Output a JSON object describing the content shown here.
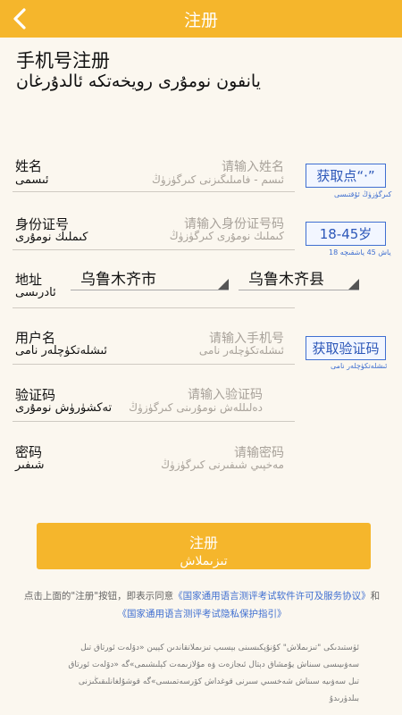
{
  "topbar": {
    "title": "注册",
    "back_label": "‹"
  },
  "heading": {
    "title_zh": "手机号注册",
    "title_ug": "يانفون نومۇرى رويخەتكە ئالدۇرغان"
  },
  "form": {
    "name": {
      "label_zh": "姓名",
      "label_ug": "ئىسمى",
      "placeholder_zh": "请输入姓名",
      "placeholder_ug": "ئىسم - فامىلىگىزنى كىرگۈزۈڭ",
      "button": "获取点“·”",
      "button_note": "كىرگۈزۈڭ ئۇقتىسى"
    },
    "id_number": {
      "label_zh": "身份证号",
      "label_ug": "كىملىك نومۇرى",
      "placeholder_zh": "请输入身份证号码",
      "placeholder_ug": "كىملىك نومۇرى كىرگۈزۈڭ",
      "button": "18-45岁",
      "button_note": "18 ياش 45 ياشقىچە"
    },
    "address": {
      "label_zh": "地址",
      "label_ug": "ئادرىسى",
      "city": "乌鲁木齐市",
      "county": "乌鲁木齐县"
    },
    "username": {
      "label_zh": "用户名",
      "label_ug": "ئىشلەتكۈچلەر نامى",
      "placeholder_zh": "请输入手机号",
      "placeholder_ug": "ئىشلەتكۈچلەر نامى",
      "button": "获取验证码",
      "button_note": "ئىشلەتكۈچلەر نامى"
    },
    "code": {
      "label_zh": "验证码",
      "label_ug": "تەكشۈرۈش نومۇرى",
      "placeholder_zh": "请输入验证码",
      "placeholder_ug": "دەلىللەش نومۇرىنى كىرگۈزۈڭ"
    },
    "password": {
      "label_zh": "密码",
      "label_ug": "شىفىر",
      "placeholder_zh": "请输密码",
      "placeholder_ug": "مەخپىي شىفىرنى كىرگۈزۈڭ"
    }
  },
  "register_button": {
    "label_zh": "注册",
    "label_ug": "تىزىملاش"
  },
  "agreement": {
    "prefix": "点击上面的\"注册\"按钮，即表示同意",
    "link1": "《国家通用语言测评考试软件许可及服务协议》",
    "conj": "和",
    "link2": "《国家通用语言测评考试隐私保护指引》",
    "ug_text": "ئۈستىدىكى \"تىزىملاش\" كۇنۇپكىسىنى بېسىپ تىزىملاتقاندىن كېيىن «دۆلەت ئورتاق تىل سەۋىيىسى سىناش يۇمشاق دېتال ئىجازەت ۋە مۇلازىمەت كېلىشىمى»گە «دۆلەت ئورتاق تىل سەۋىيە سىناش شەخسىي سىرنى قوغداش كۆرسەتمىسى»گە قوشۇلغانلىقىڭىزنى بىلدۈرىدۇ"
  }
}
